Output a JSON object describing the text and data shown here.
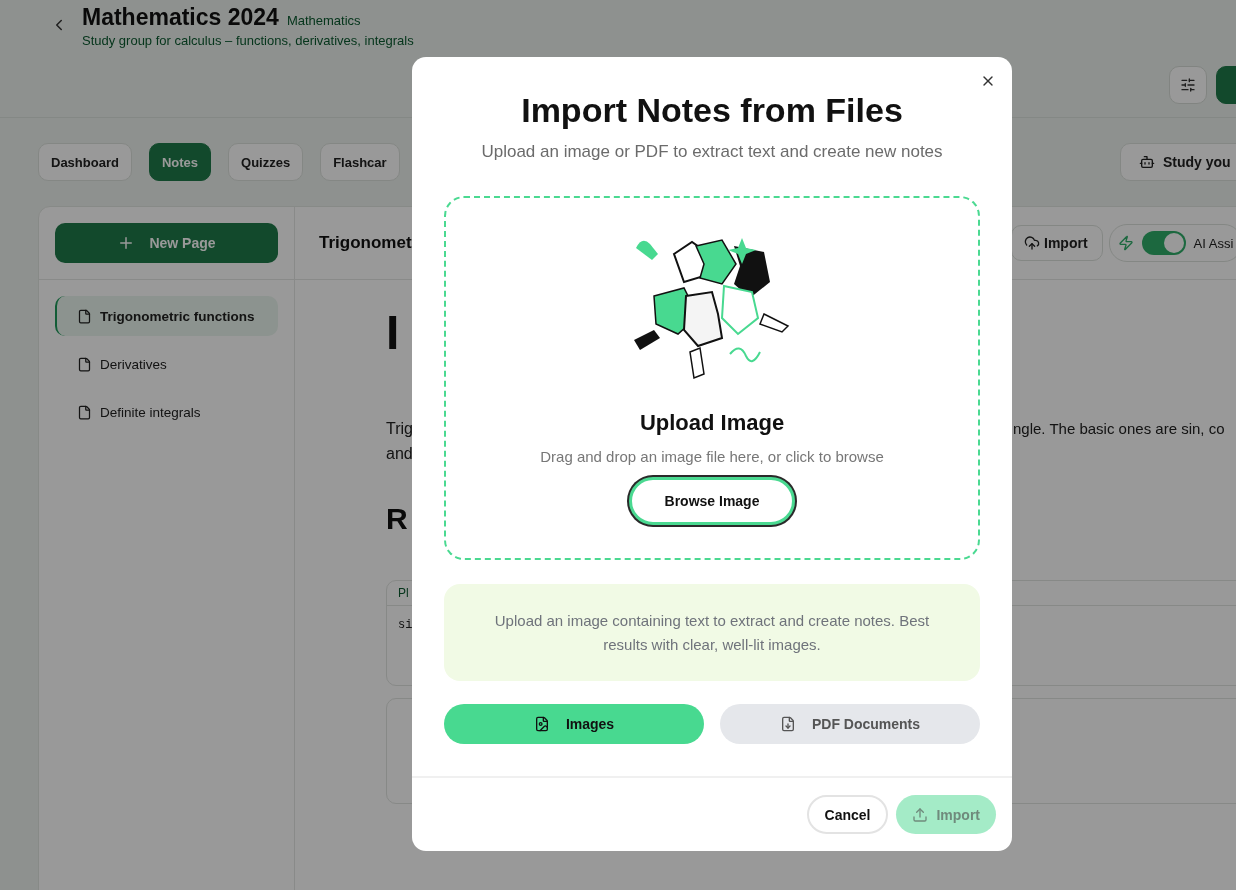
{
  "header": {
    "title": "Mathematics 2024",
    "tag": "Mathematics",
    "subtitle": "Study group for calculus – functions, derivatives, integrals"
  },
  "tabs": [
    {
      "label": "Dashboard",
      "selected": false
    },
    {
      "label": "Notes",
      "selected": true
    },
    {
      "label": "Quizzes",
      "selected": false
    },
    {
      "label": "Flashcar",
      "selected": false
    }
  ],
  "study_button": {
    "label": "Study you"
  },
  "sidebar": {
    "new_page": "New Page",
    "pages": [
      {
        "label": "Trigonometric functions",
        "selected": true
      },
      {
        "label": "Derivatives",
        "selected": false
      },
      {
        "label": "Definite integrals",
        "selected": false
      }
    ]
  },
  "editor": {
    "page_title": "Trigonomet",
    "import_button": "Import",
    "ai": {
      "label": "AI Assi",
      "on": true
    },
    "heading": "I",
    "paragraph_left": [
      "Trig",
      "and"
    ],
    "paragraph_right": "ngle. The basic ones are sin, co",
    "subheading": "R",
    "code": {
      "label": "Pl",
      "text": "si"
    }
  },
  "dialog": {
    "title": "Import Notes from Files",
    "subtitle": "Upload an image or PDF to extract text and create new notes",
    "drop_title": "Upload Image",
    "drop_hint": "Drag and drop an image file here, or click to browse",
    "browse_button": "Browse Image",
    "info": "Upload an image containing text to extract and create notes. Best results with clear, well-lit images.",
    "sources": [
      {
        "label": "Images",
        "kind": "image",
        "selected": true
      },
      {
        "label": "PDF Documents",
        "kind": "pdf",
        "selected": false
      }
    ],
    "cancel": "Cancel",
    "import": {
      "label": "Import",
      "disabled": true
    }
  }
}
